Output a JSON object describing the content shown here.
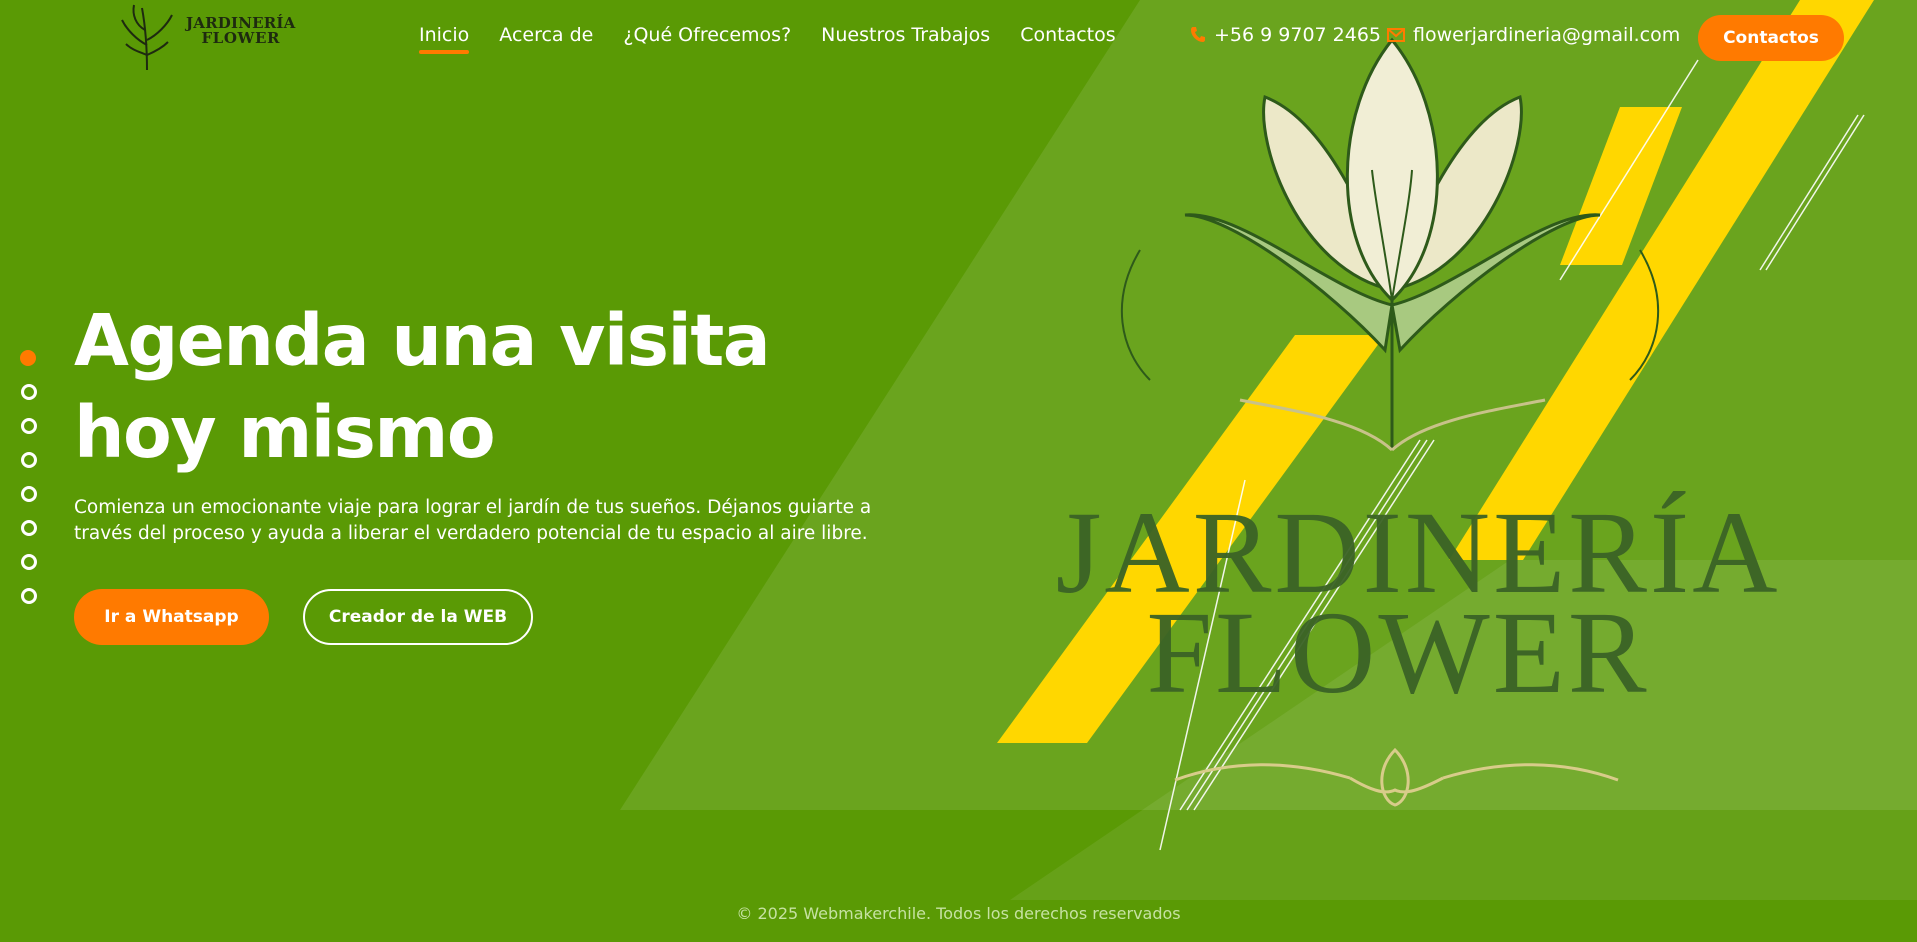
{
  "brand": {
    "line1": "JARDINERÍA",
    "line2": "FLOWER"
  },
  "nav": {
    "items": [
      {
        "label": "Inicio",
        "active": true
      },
      {
        "label": "Acerca de"
      },
      {
        "label": "¿Qué Ofrecemos?"
      },
      {
        "label": "Nuestros Trabajos"
      },
      {
        "label": "Contactos"
      }
    ],
    "phone": "+56 9 9707 2465",
    "email": "flowerjardineria@gmail.com",
    "cta_label": "Contactos"
  },
  "hero": {
    "title": "Agenda una visita hoy mismo",
    "subtitle": "Comienza un emocionante viaje para lograr el jardín de tus sueños. Déjanos guiarte a través del proceso y ayuda a liberar el verdadero potencial de tu espacio al aire libre.",
    "primary_button": "Ir a Whatsapp",
    "secondary_button": "Creador de la WEB",
    "art_title_line1": "JARDINERÍA",
    "art_title_line2": "FLOWER"
  },
  "slider": {
    "count": 8,
    "active_index": 0
  },
  "footer": {
    "text": "© 2025 Webmakerchile. Todos los derechos reservados"
  },
  "colors": {
    "background": "#5a9a05",
    "accent": "#ff7a00",
    "stripe": "#ffd700",
    "text": "#ffffff",
    "art_text": "#3b6326"
  },
  "icons": {
    "phone": "phone-icon",
    "email": "envelope-icon",
    "logo": "plant-logo-icon"
  }
}
